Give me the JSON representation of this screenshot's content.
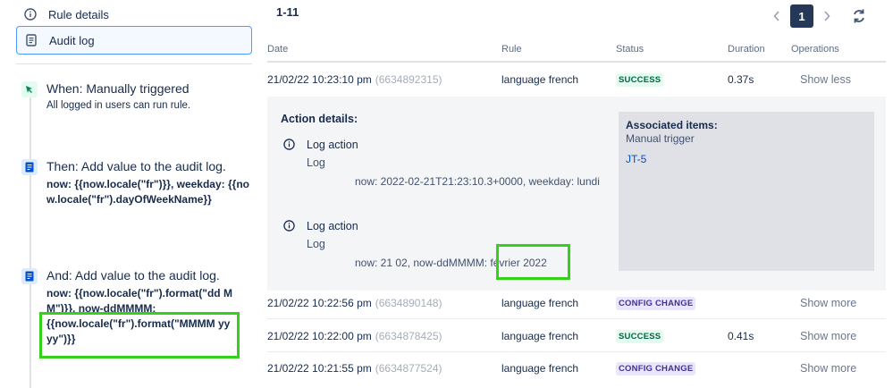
{
  "sidebar": {
    "rule_details": "Rule details",
    "audit_log": "Audit log"
  },
  "steps": {
    "trigger": {
      "title": "When: Manually triggered",
      "subtitle": "All logged in users can run rule."
    },
    "action1": {
      "title": "Then: Add value to the audit log.",
      "code": "now: {{now.locale(\"fr\")}}, weekday: {{now.locale(\"fr\").dayOfWeekName}}"
    },
    "action2": {
      "title": "And: Add value to the audit log.",
      "code1": "now: {{now.locale(\"fr\").format(\"dd MM\")}}, now-ddMMMM:",
      "code2": "{{now.locale(\"fr\").format(\"MMMM yyyy\")}}"
    }
  },
  "main": {
    "count": "1-11",
    "page": "1",
    "columns": {
      "date": "Date",
      "rule": "Rule",
      "status": "Status",
      "duration": "Duration",
      "operations": "Operations"
    },
    "rows": [
      {
        "date": "21/02/22 10:23:10 pm",
        "id": "(6634892315)",
        "rule": "language french",
        "status": "SUCCESS",
        "duration": "0.37s",
        "op": "Show less"
      },
      {
        "date": "21/02/22 10:22:56 pm",
        "id": "(6634890148)",
        "rule": "language french",
        "status": "CONFIG CHANGE",
        "duration": "",
        "op": "Show more"
      },
      {
        "date": "21/02/22 10:22:00 pm",
        "id": "(6634878425)",
        "rule": "language french",
        "status": "SUCCESS",
        "duration": "0.41s",
        "op": "Show more"
      },
      {
        "date": "21/02/22 10:21:55 pm",
        "id": "(6634877524)",
        "rule": "language french",
        "status": "CONFIG CHANGE",
        "duration": "",
        "op": "Show more"
      }
    ],
    "details": {
      "title": "Action details:",
      "logs": [
        {
          "label": "Log action",
          "kind": "Log",
          "message": "now: 2022-02-21T21:23:10.3+0000, weekday: lundi"
        },
        {
          "label": "Log action",
          "kind": "Log",
          "message": "now: 21 02, now-ddMMMM: février 2022"
        }
      ],
      "assoc": {
        "title": "Associated items:",
        "subtitle": "Manual trigger",
        "link": "JT-5"
      }
    }
  },
  "colors": {
    "success_bg": "#e3fcef",
    "success_fg": "#006644",
    "config_bg": "#eae6ff",
    "config_fg": "#403294",
    "highlight": "#33d11a",
    "link": "#0052cc"
  }
}
